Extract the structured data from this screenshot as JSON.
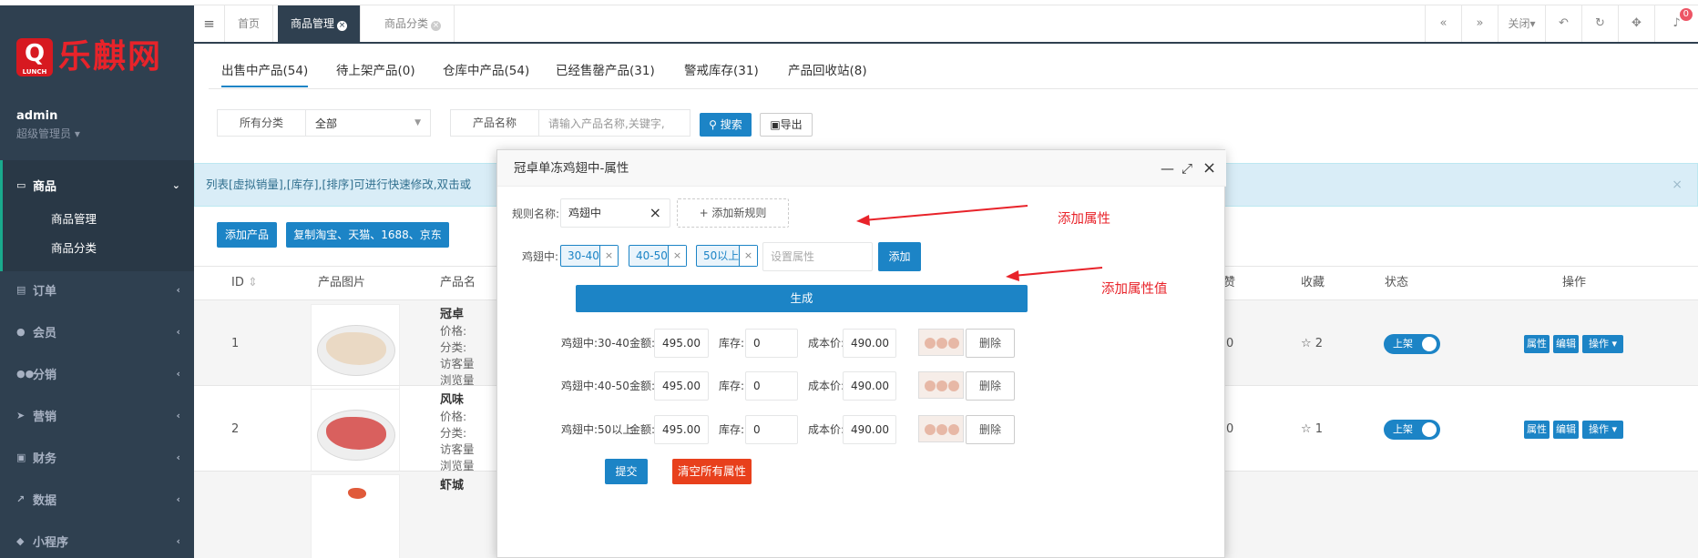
{
  "app": {
    "logo_initial": "Q",
    "logo_sub": "LUNCH",
    "logo_text": "乐麒网",
    "user_name": "admin",
    "user_role": "超级管理员 ▾"
  },
  "sidebar": {
    "items": [
      {
        "label": "商品",
        "icon": "monitor-icon",
        "active": true
      },
      {
        "label": "订单",
        "icon": "file-icon"
      },
      {
        "label": "会员",
        "icon": "user-icon"
      },
      {
        "label": "分销",
        "icon": "users-icon"
      },
      {
        "label": "营销",
        "icon": "send-icon"
      },
      {
        "label": "财务",
        "icon": "money-icon"
      },
      {
        "label": "数据",
        "icon": "chart-icon"
      },
      {
        "label": "小程序",
        "icon": "cubes-icon"
      }
    ],
    "sub_items": [
      "商品管理",
      "商品分类"
    ]
  },
  "topbar": {
    "tabs": [
      {
        "label": "首页"
      },
      {
        "label": "商品管理",
        "active": true
      },
      {
        "label": "商品分类"
      }
    ],
    "close_label": "关闭▾",
    "bell_count": "0"
  },
  "product_tabs": [
    "出售中产品(54)",
    "待上架产品(0)",
    "仓库中产品(54)",
    "已经售罄产品(31)",
    "警戒库存(31)",
    "产品回收站(8)"
  ],
  "filters": {
    "category_label": "所有分类",
    "category_value": "全部",
    "name_label": "产品名称",
    "name_placeholder": "请输入产品名称,关键字,",
    "search_label": "搜索",
    "export_label": "导出"
  },
  "alert_text": "列表[虚拟销量],[库存],[排序]可进行快速修改,双击或",
  "actions": {
    "add_product": "添加产品",
    "copy_product": "复制淘宝、天猫、1688、京东"
  },
  "table": {
    "headers": [
      "ID",
      "产品图片",
      "产品名",
      "赞",
      "收藏",
      "状态",
      "操作"
    ],
    "rows": [
      {
        "id": "1",
        "name": "冠卓",
        "meta": [
          "价格:",
          "分类:",
          "访客量",
          "浏览量"
        ],
        "likes": "0",
        "fav": "2",
        "status": "上架"
      },
      {
        "id": "2",
        "name": "风味",
        "meta": [
          "价格:",
          "分类:",
          "访客量",
          "浏览量"
        ],
        "likes": "0",
        "fav": "1",
        "status": "上架"
      },
      {
        "name": "虾城"
      }
    ],
    "op_labels": [
      "属性",
      "编辑",
      "操作 ▾"
    ]
  },
  "modal": {
    "title": "冠卓单冻鸡翅中-属性",
    "rule_label": "规则名称:",
    "rule_value": "鸡翅中",
    "add_rule": "+ 添加新规则",
    "attr_label": "鸡翅中:",
    "tags": [
      "30-40",
      "40-50",
      "50以上"
    ],
    "attr_placeholder": "设置属性",
    "add_label": "添加",
    "generate_label": "生成",
    "sku": [
      {
        "name": "鸡翅中:30-40",
        "price": "495.00",
        "stock": "0",
        "cost": "490.00"
      },
      {
        "name": "鸡翅中:40-50",
        "price": "495.00",
        "stock": "0",
        "cost": "490.00"
      },
      {
        "name": "鸡翅中:50以上",
        "price": "495.00",
        "stock": "0",
        "cost": "490.00"
      }
    ],
    "price_label": "金额:",
    "stock_label": "库存:",
    "cost_label": "成本价:",
    "delete_label": "删除",
    "submit_label": "提交",
    "clear_label": "清空所有属性"
  },
  "annotations": {
    "add_attr": "添加属性",
    "add_attr_value": "添加属性值"
  },
  "colors": {
    "sidebar": "#2f4050",
    "primary": "#1c84c6",
    "danger": "#e8401c",
    "annotation": "#e8232a"
  }
}
